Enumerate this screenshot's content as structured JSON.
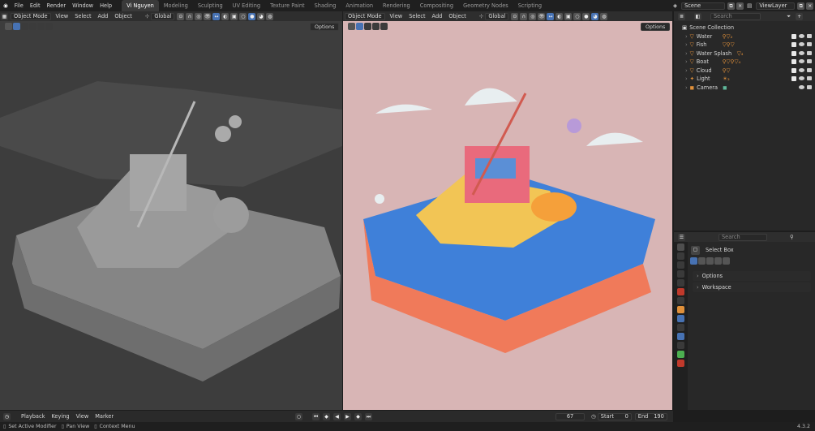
{
  "menu": [
    "File",
    "Edit",
    "Render",
    "Window",
    "Help"
  ],
  "workspaces": [
    "Vi Nguyen",
    "Modeling",
    "Sculpting",
    "UV Editing",
    "Texture Paint",
    "Shading",
    "Animation",
    "Rendering",
    "Compositing",
    "Geometry Nodes",
    "Scripting"
  ],
  "active_workspace_index": 0,
  "scene_label": "Scene",
  "viewlayer_label": "ViewLayer",
  "left_viewport": {
    "mode": "Object Mode",
    "menu": [
      "View",
      "Select",
      "Add",
      "Object"
    ],
    "orientation": "Global",
    "options": "Options"
  },
  "right_viewport": {
    "mode": "Object Mode",
    "menu": [
      "View",
      "Select",
      "Add",
      "Object"
    ],
    "orientation": "Global",
    "options": "Options"
  },
  "outliner": {
    "search_placeholder": "Search",
    "collection": "Scene Collection",
    "items": [
      {
        "name": "Water",
        "icon_color": "#e0903a"
      },
      {
        "name": "Fish",
        "icon_color": "#e0903a"
      },
      {
        "name": "Water Splash",
        "icon_color": "#e0903a"
      },
      {
        "name": "Boat",
        "icon_color": "#e0903a"
      },
      {
        "name": "Cloud",
        "icon_color": "#e0903a"
      },
      {
        "name": "Light",
        "icon_color": "#e0903a"
      },
      {
        "name": "Camera",
        "icon_color": "#e0903a"
      }
    ]
  },
  "properties": {
    "search_placeholder": "Search",
    "tool_name": "Select Box",
    "sections": [
      "Options",
      "Workspace"
    ]
  },
  "timeline": {
    "menu": [
      "Playback",
      "Keying",
      "View",
      "Marker"
    ],
    "current_frame": "67",
    "start_label": "Start",
    "start": "0",
    "end_label": "End",
    "end": "190"
  },
  "status_bar": {
    "items": [
      "Set Active Modifier",
      "Pan View",
      "Context Menu"
    ],
    "version": "4.3.2"
  },
  "colors": {
    "accent": "#4772b3",
    "viewport_bg_left": "#3d3d3d",
    "viewport_bg_right": "#d8b5b5",
    "water": "#3f80d9",
    "base": "#f07a5a"
  }
}
